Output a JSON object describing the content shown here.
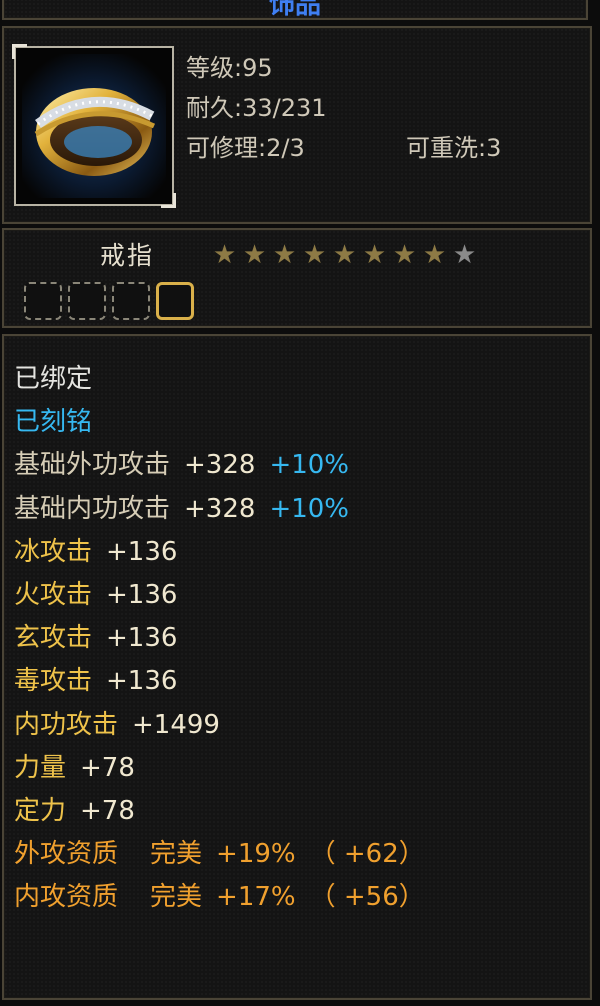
{
  "tooltip": {
    "title": "饰品",
    "item": {
      "icon": "gold-ring-icon",
      "level_label": "等级",
      "level": "95",
      "durability_label": "耐久",
      "durability": "33/231",
      "repair_label": "可修理",
      "repair": "2/3",
      "rewash_label": "可重洗",
      "rewash": "3",
      "name": "戒指",
      "stars_filled": 8,
      "stars_total": 9,
      "gem_slots": 4,
      "gem_slots_lit": 1
    },
    "stats": [
      {
        "text": "已绑定",
        "color": "white"
      },
      {
        "text": "已刻铭",
        "color": "cyan"
      },
      {
        "name": "基础外功攻击",
        "value": "+328",
        "bonus": "+10%",
        "color": "beige"
      },
      {
        "name": "基础内功攻击",
        "value": "+328",
        "bonus": "+10%",
        "color": "beige"
      },
      {
        "name": "冰攻击",
        "value": "+136",
        "color": "yellow"
      },
      {
        "name": "火攻击",
        "value": "+136",
        "color": "yellow"
      },
      {
        "name": "玄攻击",
        "value": "+136",
        "color": "yellow"
      },
      {
        "name": "毒攻击",
        "value": "+136",
        "color": "yellow"
      },
      {
        "name": "内功攻击",
        "value": "+1499",
        "color": "yellow"
      },
      {
        "name": "力量",
        "value": "+78",
        "color": "yellow"
      },
      {
        "name": "定力",
        "value": "+78",
        "color": "yellow"
      },
      {
        "name": "外攻资质",
        "grade": "完美",
        "value": "+19%",
        "extra": "（ +62）",
        "color": "orange"
      },
      {
        "name": "内攻资质",
        "grade": "完美",
        "value": "+17%",
        "extra": "（ +56）",
        "color": "orange"
      }
    ],
    "colors": {
      "white": "#e4e4e0",
      "cyan": "#36b8f0",
      "beige": "#d6cdb6",
      "yellow": "#eec24a",
      "orange": "#f0a02e",
      "title_blue": "#3f7ff2"
    }
  }
}
